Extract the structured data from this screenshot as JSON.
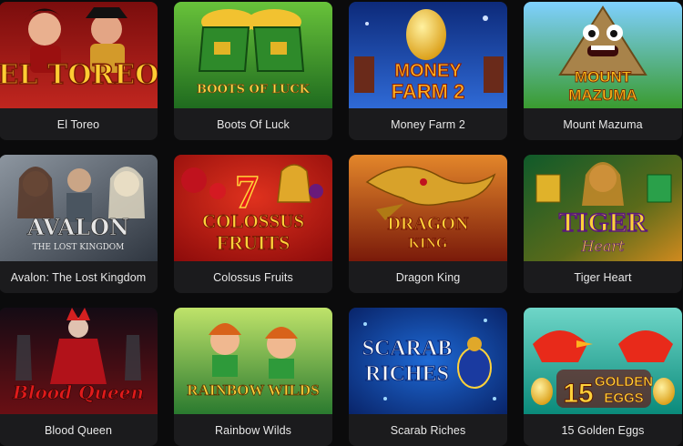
{
  "games": [
    {
      "id": "el-toreo",
      "title": "El Toreo",
      "logo": [
        "EL TOREO"
      ],
      "icon": "el-toreo-artwork",
      "colors": {
        "bg1": "#7a0d0d",
        "bg2": "#c0261f",
        "logo": "#ffcc33"
      }
    },
    {
      "id": "boots-of-luck",
      "title": "Boots Of Luck",
      "logo": [
        "BOOTS OF LUCK"
      ],
      "icon": "boots-of-luck-artwork",
      "colors": {
        "bg1": "#1f6b1f",
        "bg2": "#68c23a",
        "logo": "#ffd84a"
      }
    },
    {
      "id": "money-farm-2",
      "title": "Money Farm 2",
      "logo": [
        "MONEY",
        "FARM 2"
      ],
      "icon": "money-farm-artwork",
      "colors": {
        "bg1": "#0d2a7a",
        "bg2": "#2f6ad6",
        "logo": "#ffb21f"
      }
    },
    {
      "id": "mount-mazuma",
      "title": "Mount Mazuma",
      "logo": [
        "MOUNT",
        "MAZUMA"
      ],
      "icon": "mount-mazuma-artwork",
      "colors": {
        "bg1": "#3a9b2f",
        "bg2": "#7fd0ff",
        "logo": "#ffc21a"
      }
    },
    {
      "id": "avalon",
      "title": "Avalon: The Lost Kingdom",
      "logo": [
        "AVALON",
        "THE LOST KINGDOM"
      ],
      "icon": "avalon-artwork",
      "colors": {
        "bg1": "#2f3640",
        "bg2": "#8d96a0",
        "logo": "#e6e6e6"
      }
    },
    {
      "id": "colossus-fruits",
      "title": "Colossus Fruits",
      "logo": [
        "COLOSSUS",
        "FRUITS"
      ],
      "icon": "colossus-fruits-artwork",
      "colors": {
        "bg1": "#8a0a0a",
        "bg2": "#e0321e",
        "logo": "#ffd23a"
      }
    },
    {
      "id": "dragon-king",
      "title": "Dragon King",
      "logo": [
        "DRAGON",
        "KING"
      ],
      "icon": "dragon-king-artwork",
      "colors": {
        "bg1": "#7a1a0a",
        "bg2": "#e3862a",
        "logo": "#ffd23a"
      }
    },
    {
      "id": "tiger-heart",
      "title": "Tiger Heart",
      "logo": [
        "TIGER",
        "Heart"
      ],
      "icon": "tiger-heart-artwork",
      "colors": {
        "bg1": "#0f5a2a",
        "bg2": "#d08a1e",
        "logo": "#ffd23a"
      }
    },
    {
      "id": "blood-queen",
      "title": "Blood Queen",
      "logo": [
        "Blood Queen"
      ],
      "icon": "blood-queen-artwork",
      "colors": {
        "bg1": "#140b14",
        "bg2": "#6a0f14",
        "logo": "#e01b1b"
      }
    },
    {
      "id": "rainbow-wilds",
      "title": "Rainbow Wilds",
      "logo": [
        "RAINBOW WILDS"
      ],
      "icon": "rainbow-wilds-artwork",
      "colors": {
        "bg1": "#2a7a2f",
        "bg2": "#bfe36a",
        "logo": "#ffd23a"
      }
    },
    {
      "id": "scarab-riches",
      "title": "Scarab Riches",
      "logo": [
        "SCARAB",
        "RICHES"
      ],
      "icon": "scarab-riches-artwork",
      "colors": {
        "bg1": "#061a5a",
        "bg2": "#1e6ad6",
        "logo": "#f5f5f5"
      }
    },
    {
      "id": "15-golden-eggs",
      "title": "15 Golden Eggs",
      "logo": [
        "15",
        "GOLDEN",
        "EGGS"
      ],
      "icon": "golden-eggs-artwork",
      "colors": {
        "bg1": "#0a8a7a",
        "bg2": "#6fd6c8",
        "logo": "#ffd23a"
      }
    }
  ]
}
